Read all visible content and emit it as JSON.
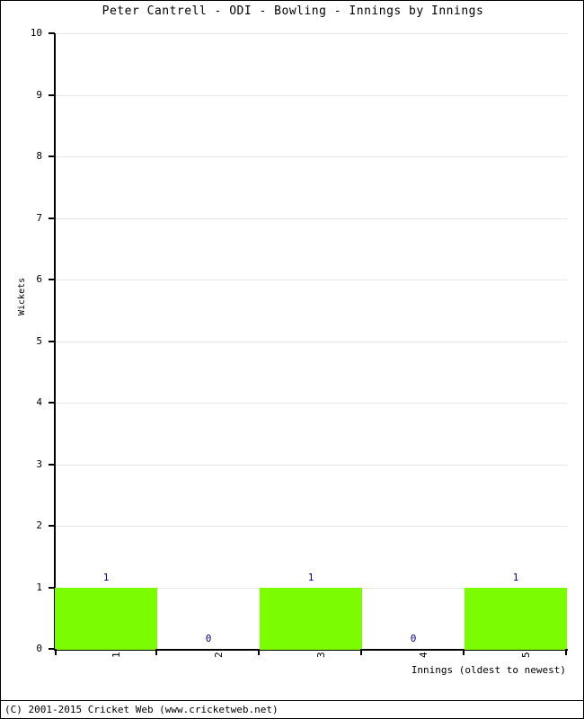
{
  "chart_data": {
    "type": "bar",
    "title": "Peter Cantrell - ODI - Bowling - Innings by Innings",
    "xlabel": "Innings (oldest to newest)",
    "ylabel": "Wickets",
    "categories": [
      "1",
      "2",
      "3",
      "4",
      "5"
    ],
    "values": [
      1,
      0,
      1,
      0,
      1
    ],
    "value_labels": [
      "1",
      "0",
      "1",
      "0",
      "1"
    ],
    "ylim": [
      0,
      10
    ],
    "ytick_labels": [
      "0",
      "1",
      "2",
      "3",
      "4",
      "5",
      "6",
      "7",
      "8",
      "9",
      "10"
    ],
    "ytick_values": [
      0,
      1,
      2,
      3,
      4,
      5,
      6,
      7,
      8,
      9,
      10
    ],
    "grid": true,
    "legend": false,
    "series": [
      {
        "name": "Wickets",
        "values": [
          1,
          0,
          1,
          0,
          1
        ],
        "color": "#7cfc00"
      }
    ],
    "colors": {
      "bar": "#7cfc00",
      "value_label": "#00008b",
      "gridline": "#e6e6e6",
      "axis": "#000000",
      "background": "#ffffff"
    }
  },
  "footer": {
    "copyright": "(C) 2001-2015 Cricket Web (www.cricketweb.net)"
  }
}
